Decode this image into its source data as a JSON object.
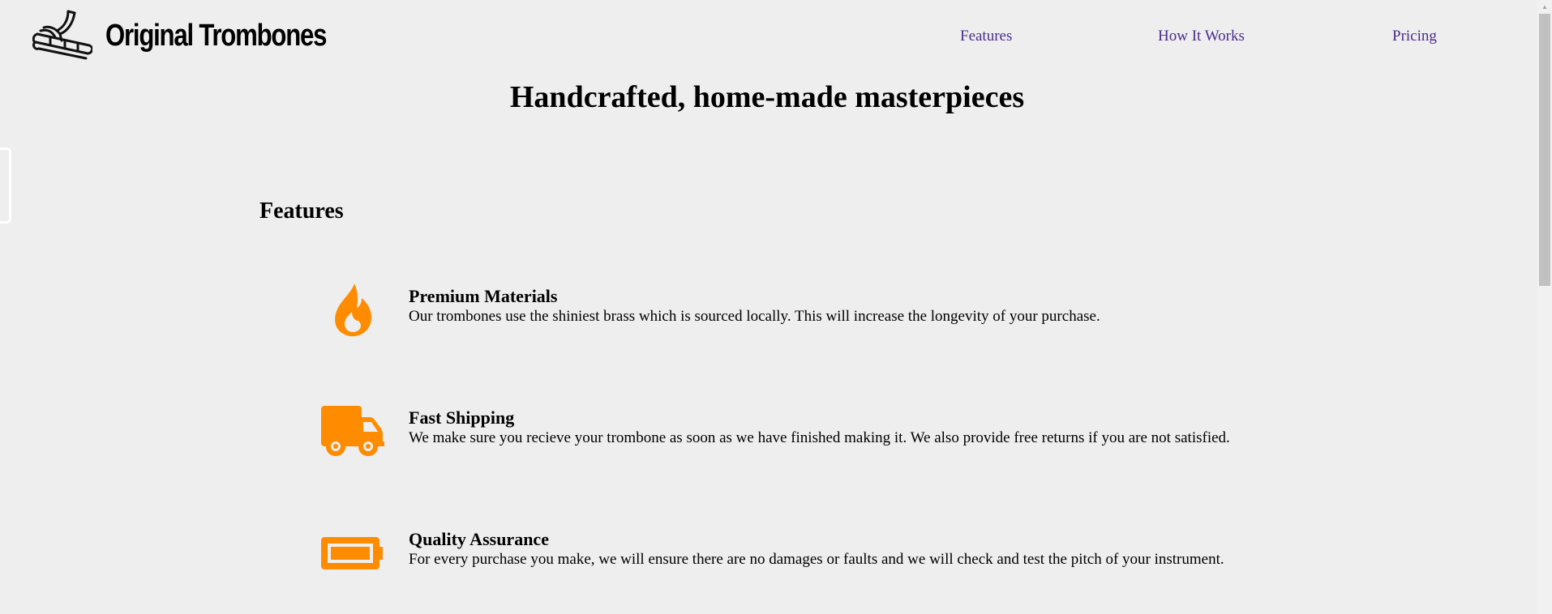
{
  "header": {
    "logo_text": "Original Trombones",
    "logo_icon": "trombone-icon"
  },
  "nav": {
    "items": [
      {
        "label": "Features"
      },
      {
        "label": "How It Works"
      },
      {
        "label": "Pricing"
      }
    ],
    "link_color": "#4b2c8c"
  },
  "hero": {
    "title": "Handcrafted, home-made masterpieces"
  },
  "features": {
    "heading": "Features",
    "icon_color": "#ff8c00",
    "items": [
      {
        "icon": "fire-icon",
        "title": "Premium Materials",
        "description": "Our trombones use the shiniest brass which is sourced locally. This will increase the longevity of your purchase."
      },
      {
        "icon": "truck-icon",
        "title": "Fast Shipping",
        "description": "We make sure you recieve your trombone as soon as we have finished making it. We also provide free returns if you are not satisfied."
      },
      {
        "icon": "battery-icon",
        "title": "Quality Assurance",
        "description": "For every purchase you make, we will ensure there are no damages or faults and we will check and test the pitch of your instrument."
      }
    ]
  },
  "colors": {
    "background": "#eeeeee",
    "text": "#000000"
  }
}
